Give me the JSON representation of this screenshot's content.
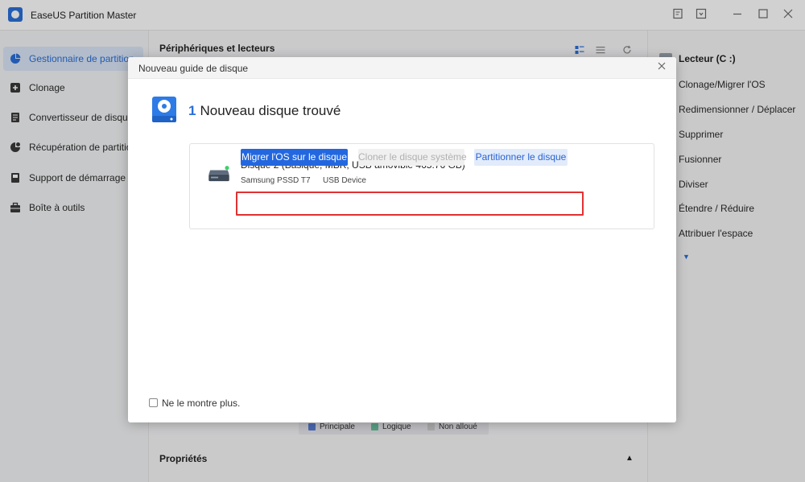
{
  "app": {
    "title": "EaseUS Partition Master"
  },
  "sidebar": {
    "items": [
      {
        "label": "Gestionnaire de partition"
      },
      {
        "label": "Clonage"
      },
      {
        "label": "Convertisseur de disque"
      },
      {
        "label": "Récupération de partition"
      },
      {
        "label": "Support de démarrage"
      },
      {
        "label": "Boîte à outils"
      }
    ]
  },
  "center": {
    "title": "Périphériques et lecteurs",
    "legend": [
      {
        "label": "Principale",
        "color": "#5b7fd6"
      },
      {
        "label": "Logique",
        "color": "#6cc3a0"
      },
      {
        "label": "Non alloué",
        "color": "#d0d0d0"
      }
    ],
    "properties_title": "Propriétés"
  },
  "right_panel": {
    "drive_title": "Lecteur (C :)",
    "operations": [
      {
        "label": "Clonage/Migrer l'OS"
      },
      {
        "label": "Redimensionner / Déplacer"
      },
      {
        "label": "Supprimer"
      },
      {
        "label": "Fusionner"
      },
      {
        "label": "Diviser"
      },
      {
        "label": "Étendre / Réduire"
      },
      {
        "label": "Attribuer l'espace"
      }
    ]
  },
  "modal": {
    "title": "Nouveau guide de disque",
    "found_count": "1",
    "found_text": "Nouveau disque trouvé",
    "disk": {
      "name": "Disque 2 (Basique, MBR, USB amovible 465.76 GB)",
      "model": "Samsung  PSSD T7",
      "interface": "USB Device"
    },
    "buttons": {
      "migrate": "Migrer l'OS sur le disque",
      "clone": "Cloner le disque système",
      "partition": "Partitionner le disque"
    },
    "dont_show": "Ne le montre plus."
  },
  "colors": {
    "accent": "#2367e0",
    "highlight_border": "#e03232",
    "disk_status": "#3fcf6a"
  }
}
